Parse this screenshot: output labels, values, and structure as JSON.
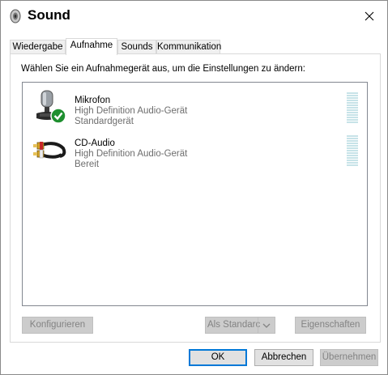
{
  "window": {
    "title": "Sound",
    "close_label": "×"
  },
  "tabs": [
    {
      "label": "Wiedergabe",
      "active": false
    },
    {
      "label": "Aufnahme",
      "active": true
    },
    {
      "label": "Sounds",
      "active": false
    },
    {
      "label": "Kommunikation",
      "active": false
    }
  ],
  "instruction": "Wählen Sie ein Aufnahmegerät aus, um die Einstellungen zu ändern:",
  "devices": [
    {
      "name": "Mikrofon",
      "line1": "High Definition Audio-Gerät",
      "line2": "Standardgerät",
      "icon": "microphone-icon",
      "default": true
    },
    {
      "name": "CD-Audio",
      "line1": "High Definition Audio-Gerät",
      "line2": "Bereit",
      "icon": "cd-audio-cable-icon",
      "default": false
    }
  ],
  "buttons": {
    "configure": "Konfigurieren",
    "set_default": "Als Standarc",
    "properties": "Eigenschaften",
    "ok": "OK",
    "cancel": "Abbrechen",
    "apply": "Übernehmen"
  },
  "colors": {
    "accent": "#0078d7",
    "check_green": "#1e8f2f",
    "meter": "#c7e3e8"
  }
}
